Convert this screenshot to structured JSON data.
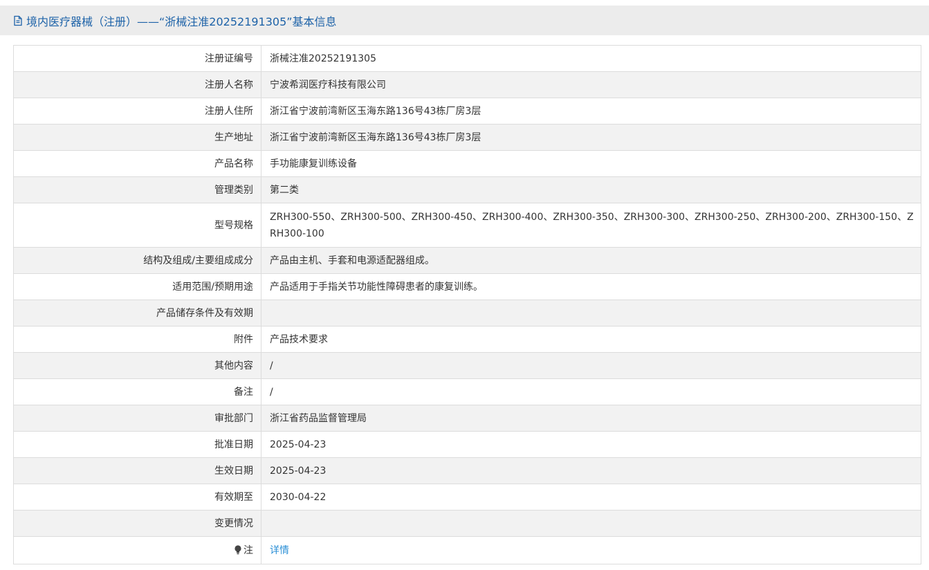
{
  "header": {
    "icon": "document-icon",
    "title": "境内医疗器械（注册）——“浙械注准20252191305”基本信息"
  },
  "rows": [
    {
      "label": "注册证编号",
      "value": "浙械注准20252191305"
    },
    {
      "label": "注册人名称",
      "value": "宁波希润医疗科技有限公司"
    },
    {
      "label": "注册人住所",
      "value": "浙江省宁波前湾新区玉海东路136号43栋厂房3层"
    },
    {
      "label": "生产地址",
      "value": "浙江省宁波前湾新区玉海东路136号43栋厂房3层"
    },
    {
      "label": "产品名称",
      "value": "手功能康复训练设备"
    },
    {
      "label": "管理类别",
      "value": "第二类"
    },
    {
      "label": "型号规格",
      "value": "ZRH300-550、ZRH300-500、ZRH300-450、ZRH300-400、ZRH300-350、ZRH300-300、ZRH300-250、ZRH300-200、ZRH300-150、ZRH300-100"
    },
    {
      "label": "结构及组成/主要组成成分",
      "value": "产品由主机、手套和电源适配器组成。"
    },
    {
      "label": "适用范围/预期用途",
      "value": "产品适用于手指关节功能性障碍患者的康复训练。"
    },
    {
      "label": "产品储存条件及有效期",
      "value": ""
    },
    {
      "label": "附件",
      "value": "产品技术要求"
    },
    {
      "label": "其他内容",
      "value": "/"
    },
    {
      "label": "备注",
      "value": "/"
    },
    {
      "label": "审批部门",
      "value": "浙江省药品监督管理局"
    },
    {
      "label": "批准日期",
      "value": "2025-04-23"
    },
    {
      "label": "生效日期",
      "value": "2025-04-23"
    },
    {
      "label": "有效期至",
      "value": "2030-04-22"
    },
    {
      "label": "变更情况",
      "value": ""
    }
  ],
  "note": {
    "icon": "lightbulb-icon",
    "label": "注",
    "link_text": "详情"
  },
  "colors": {
    "header_bg": "#ececec",
    "header_text": "#1d62a8",
    "stripe": "#f2f2f2",
    "border": "#dcdcdc",
    "link": "#2b8fd6"
  }
}
